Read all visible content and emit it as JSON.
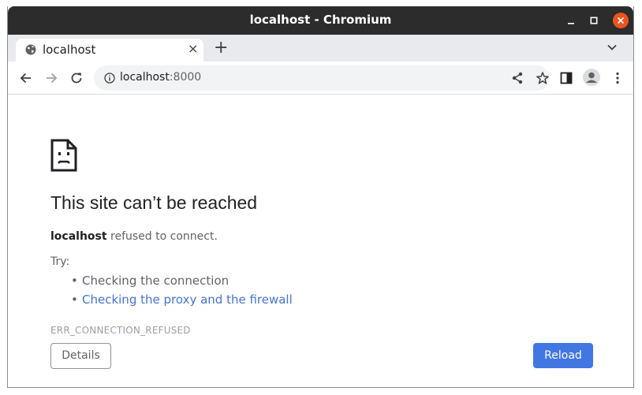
{
  "window": {
    "title": "localhost - Chromium",
    "controls": {
      "minimize": "minimize-icon",
      "maximize": "maximize-icon",
      "close": "close-icon",
      "close_color": "#e95420"
    }
  },
  "tabs": [
    {
      "label": "localhost",
      "icon": "globe-icon",
      "close_label": "×"
    }
  ],
  "tabstrip": {
    "new_tab": "+",
    "tab_search_icon": "chevron-down-icon"
  },
  "toolbar": {
    "back_icon": "arrow-left-icon",
    "forward_icon": "arrow-right-icon",
    "reload_icon": "reload-icon",
    "site_info_icon": "info-icon",
    "url_host": "localhost",
    "url_port": ":8000",
    "share_icon": "share-icon",
    "bookmark_icon": "star-icon",
    "sidepanel_icon": "side-panel-icon",
    "profile_icon": "avatar",
    "menu_icon": "kebab-menu-icon"
  },
  "error": {
    "icon": "sad-page-icon",
    "heading": "This site can’t be reached",
    "host": "localhost",
    "message": " refused to connect.",
    "try_label": "Try:",
    "suggestions": [
      {
        "text": "Checking the connection",
        "link": false
      },
      {
        "text": "Checking the proxy and the firewall",
        "link": true
      }
    ],
    "code": "ERR_CONNECTION_REFUSED",
    "details_button": "Details",
    "reload_button": "Reload",
    "accent_color": "#4276e2"
  }
}
